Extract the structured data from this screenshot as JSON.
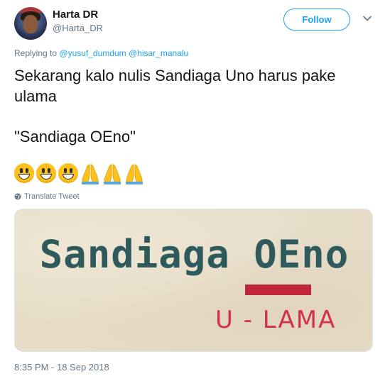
{
  "user": {
    "name": "Harta DR",
    "handle": "@Harta_DR"
  },
  "follow_label": "Follow",
  "reply": {
    "prefix": "Replying to",
    "mentions": [
      "@yusuf_dumdum",
      "@hisar_manalu"
    ]
  },
  "tweet": {
    "line1": "Sekarang kalo nulis Sandiaga Uno harus pake ulama",
    "line2": "\"Sandiaga OEno\"",
    "emojis": [
      "grinning-face",
      "grinning-face",
      "grinning-face",
      "folded-hands",
      "folded-hands",
      "folded-hands"
    ]
  },
  "translate_label": "Translate Tweet",
  "media": {
    "title": "Sandiaga OEno",
    "subtitle": "U - LAMA",
    "title_color": "#2e5a5c",
    "accent_color": "#c2263c"
  },
  "timestamp": "8:35 PM - 18 Sep 2018",
  "colors": {
    "link": "#1da1f2",
    "muted": "#657786",
    "text": "#14171a"
  }
}
